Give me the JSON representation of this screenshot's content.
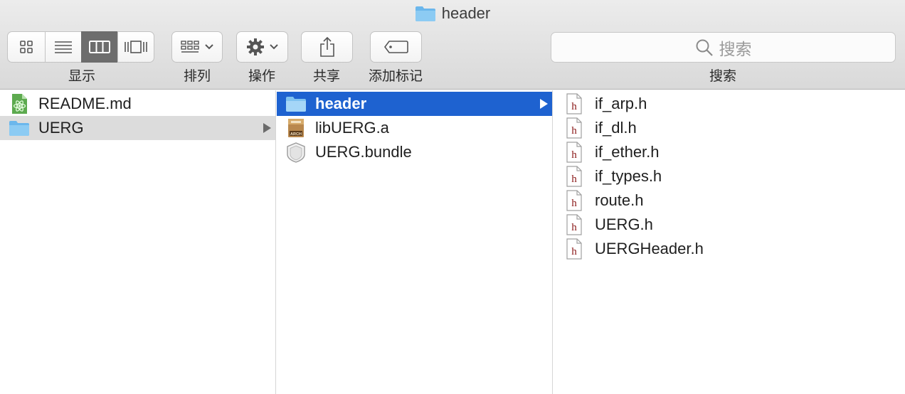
{
  "window": {
    "title": "header"
  },
  "toolbar": {
    "view_label": "显示",
    "view_modes": [
      "icon-view",
      "list-view",
      "column-view",
      "coverflow-view"
    ],
    "selected_view": "column-view",
    "arrange_label": "排列",
    "action_label": "操作",
    "share_label": "共享",
    "tags_label": "添加标记",
    "search_label": "搜索",
    "search_placeholder": "搜索"
  },
  "columns": [
    {
      "items": [
        {
          "name": "README.md",
          "icon": "atom-document-icon"
        },
        {
          "name": "UERG",
          "icon": "folder-icon",
          "state": "selected-inactive",
          "has_children": true
        }
      ]
    },
    {
      "items": [
        {
          "name": "header",
          "icon": "folder-icon",
          "state": "selected-active",
          "has_children": true
        },
        {
          "name": "libUERG.a",
          "icon": "archive-icon"
        },
        {
          "name": "UERG.bundle",
          "icon": "bundle-icon"
        }
      ]
    },
    {
      "items": [
        {
          "name": "if_arp.h",
          "icon": "header-file-icon"
        },
        {
          "name": "if_dl.h",
          "icon": "header-file-icon"
        },
        {
          "name": "if_ether.h",
          "icon": "header-file-icon"
        },
        {
          "name": "if_types.h",
          "icon": "header-file-icon"
        },
        {
          "name": "route.h",
          "icon": "header-file-icon"
        },
        {
          "name": "UERG.h",
          "icon": "header-file-icon"
        },
        {
          "name": "UERGHeader.h",
          "icon": "header-file-icon"
        }
      ]
    }
  ],
  "colors": {
    "selection_active": "#1e62d0",
    "selection_inactive": "#dcdcdc",
    "folder": "#6bb7ec",
    "header_file_letter": "#8b1a1a"
  }
}
